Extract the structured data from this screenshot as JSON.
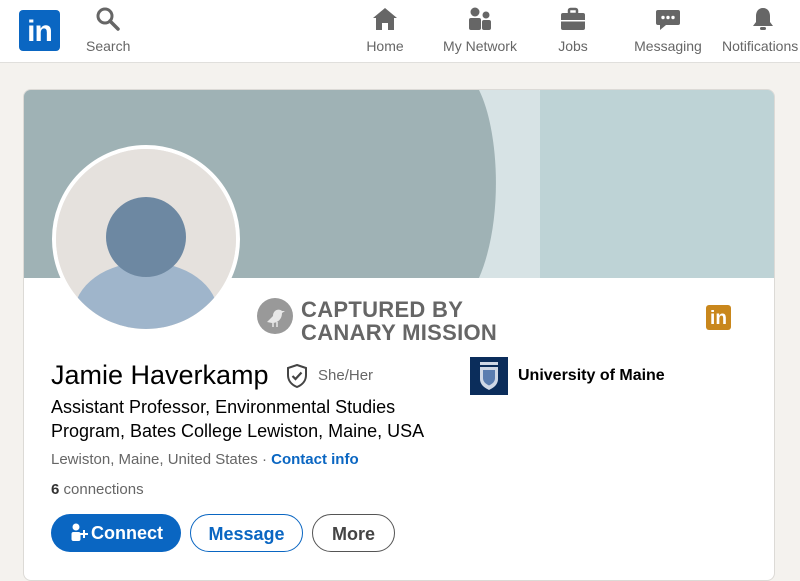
{
  "nav": {
    "logo_text": "in",
    "items": [
      {
        "label": "Search",
        "icon": "search-icon"
      },
      {
        "label": "Home",
        "icon": "home-icon"
      },
      {
        "label": "My Network",
        "icon": "network-icon"
      },
      {
        "label": "Jobs",
        "icon": "briefcase-icon"
      },
      {
        "label": "Messaging",
        "icon": "messaging-icon"
      },
      {
        "label": "Notifications",
        "icon": "bell-icon"
      }
    ]
  },
  "watermark": {
    "line1": "CAPTURED BY",
    "line2": "CANARY MISSION",
    "badge_text": "in"
  },
  "profile": {
    "name": "Jamie Haverkamp",
    "pronouns": "She/Her",
    "headline": "Assistant Professor, Environmental Studies Program, Bates College Lewiston, Maine, USA",
    "location": "Lewiston, Maine, United States",
    "separator": " · ",
    "contact_info": "Contact info",
    "connections_count": "6",
    "connections_label": " connections",
    "education": "University of Maine"
  },
  "actions": {
    "connect": "Connect",
    "message": "Message",
    "more": "More"
  },
  "colors": {
    "brand": "#0a66c2",
    "banner": "#bed3d6",
    "watermark_badge": "#c9871c"
  }
}
